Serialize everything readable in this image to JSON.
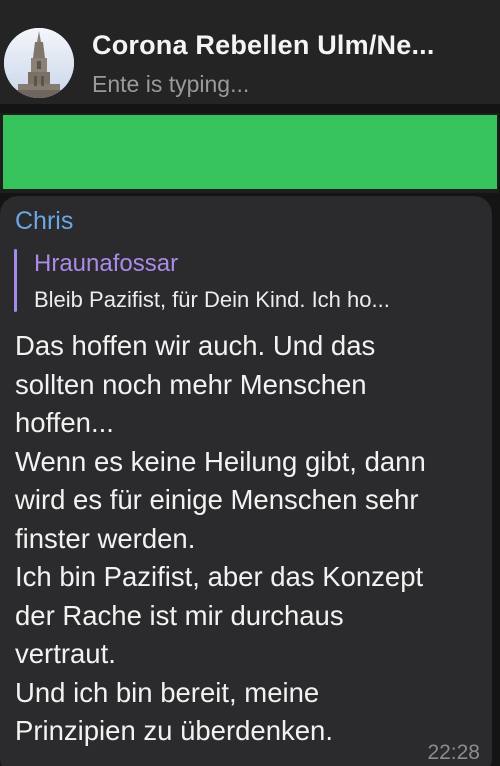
{
  "header": {
    "title": "Corona Rebellen Ulm/Ne...",
    "status": "Ente is typing...",
    "avatar_icon": "ulm-minster-avatar-icon"
  },
  "banner": {
    "color": "#36c35c"
  },
  "message": {
    "sender": "Chris",
    "sender_color": "#6aa7e3",
    "reply": {
      "author": "Hraunafossar",
      "author_color": "#a98be8",
      "text": "Bleib Pazifist, für Dein Kind. Ich ho..."
    },
    "lines": [
      "Das hoffen wir auch. Und das",
      "sollten noch mehr Menschen",
      "hoffen...",
      "Wenn es keine Heilung gibt, dann",
      "wird es für einige Menschen sehr",
      "finster werden.",
      "Ich bin Pazifist, aber das Konzept",
      "der Rache ist mir durchaus",
      "vertraut.",
      "Und ich bin bereit, meine",
      "Prinzipien zu überdenken."
    ],
    "time": "22:28"
  }
}
